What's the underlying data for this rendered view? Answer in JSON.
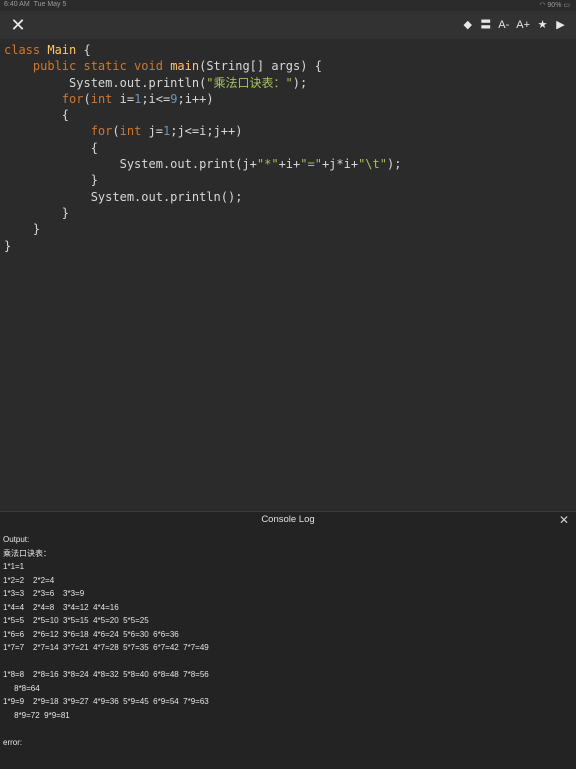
{
  "status_bar": {
    "time": "6:40 AM",
    "date": "Tue May 5",
    "battery": "90%"
  },
  "toolbar": {
    "close_icon": "close-icon",
    "tools": [
      {
        "name": "diamond-icon",
        "glyph": "◆"
      },
      {
        "name": "menu-icon",
        "glyph": "〓"
      },
      {
        "name": "font-decrease-button",
        "glyph": "A-"
      },
      {
        "name": "font-increase-button",
        "glyph": "A+"
      },
      {
        "name": "star-icon",
        "glyph": "★"
      },
      {
        "name": "run-icon",
        "glyph": "▶"
      }
    ]
  },
  "code": [
    [
      {
        "t": "kw",
        "v": "class"
      },
      {
        "t": "plain",
        "v": " "
      },
      {
        "t": "cls",
        "v": "Main"
      },
      {
        "t": "plain",
        "v": " {"
      }
    ],
    [
      {
        "t": "plain",
        "v": "    "
      },
      {
        "t": "kw",
        "v": "public static void"
      },
      {
        "t": "plain",
        "v": " "
      },
      {
        "t": "cls",
        "v": "main"
      },
      {
        "t": "plain",
        "v": "(String[] args) {"
      }
    ],
    [
      {
        "t": "plain",
        "v": "         System.out.println("
      },
      {
        "t": "str",
        "v": "\"乘法口诀表：\""
      },
      {
        "t": "plain",
        "v": ");"
      }
    ],
    [
      {
        "t": "plain",
        "v": "        "
      },
      {
        "t": "kw",
        "v": "for"
      },
      {
        "t": "plain",
        "v": "("
      },
      {
        "t": "kw",
        "v": "int"
      },
      {
        "t": "plain",
        "v": " i="
      },
      {
        "t": "num",
        "v": "1"
      },
      {
        "t": "plain",
        "v": ";i<="
      },
      {
        "t": "num",
        "v": "9"
      },
      {
        "t": "plain",
        "v": ";i++)"
      }
    ],
    [
      {
        "t": "plain",
        "v": "        {"
      }
    ],
    [
      {
        "t": "plain",
        "v": "            "
      },
      {
        "t": "kw",
        "v": "for"
      },
      {
        "t": "plain",
        "v": "("
      },
      {
        "t": "kw",
        "v": "int"
      },
      {
        "t": "plain",
        "v": " j="
      },
      {
        "t": "num",
        "v": "1"
      },
      {
        "t": "plain",
        "v": ";j<=i;j++)"
      }
    ],
    [
      {
        "t": "plain",
        "v": "            {"
      }
    ],
    [
      {
        "t": "plain",
        "v": "                System.out.print(j+"
      },
      {
        "t": "str",
        "v": "\"*\""
      },
      {
        "t": "plain",
        "v": "+i+"
      },
      {
        "t": "str",
        "v": "\"=\""
      },
      {
        "t": "plain",
        "v": "+j*i+"
      },
      {
        "t": "str",
        "v": "\"\\t\""
      },
      {
        "t": "plain",
        "v": ");"
      }
    ],
    [
      {
        "t": "plain",
        "v": "            }"
      }
    ],
    [
      {
        "t": "plain",
        "v": "            System.out.println();"
      }
    ],
    [
      {
        "t": "plain",
        "v": "        }"
      }
    ],
    [
      {
        "t": "plain",
        "v": "    }"
      }
    ],
    [
      {
        "t": "plain",
        "v": "}"
      }
    ]
  ],
  "console": {
    "title": "Console Log",
    "lines": [
      "Output:",
      "乘法口诀表：",
      "1*1=1",
      "1*2=2    2*2=4",
      "1*3=3    2*3=6    3*3=9",
      "1*4=4    2*4=8    3*4=12  4*4=16",
      "1*5=5    2*5=10  3*5=15  4*5=20  5*5=25",
      "1*6=6    2*6=12  3*6=18  4*6=24  5*6=30  6*6=36",
      "1*7=7    2*7=14  3*7=21  4*7=28  5*7=35  6*7=42  7*7=49",
      "",
      "1*8=8    2*8=16  3*8=24  4*8=32  5*8=40  6*8=48  7*8=56",
      "     8*8=64",
      "1*9=9    2*9=18  3*9=27  4*9=36  5*9=45  6*9=54  7*9=63",
      "     8*9=72  9*9=81",
      "",
      "error:"
    ]
  }
}
